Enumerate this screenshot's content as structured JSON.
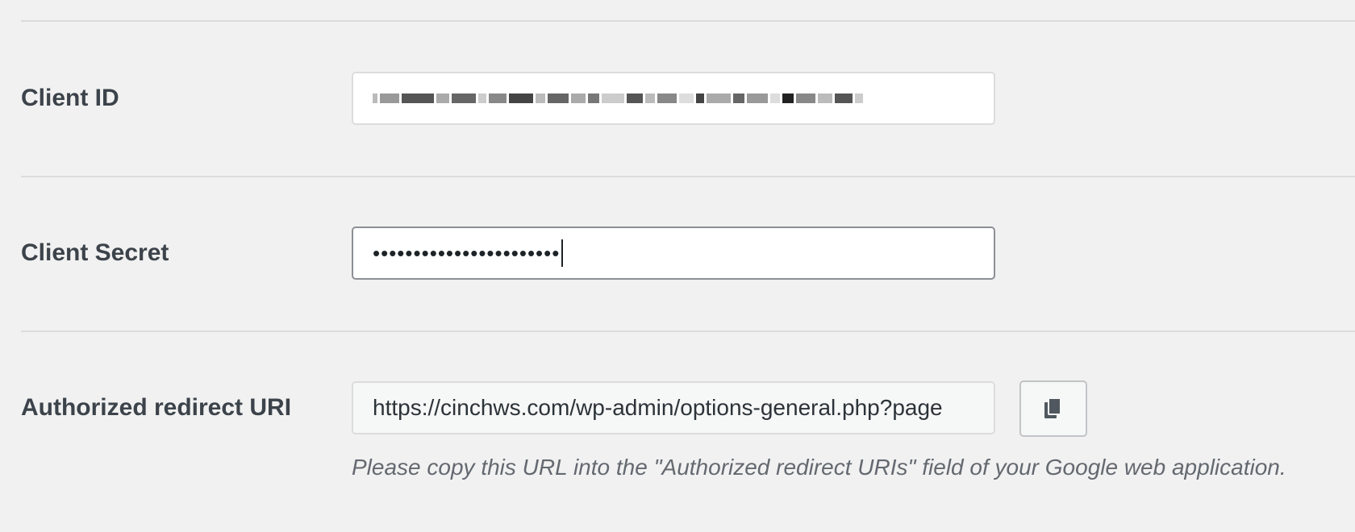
{
  "client_id": {
    "label": "Client ID",
    "value_redacted": true
  },
  "client_secret": {
    "label": "Client Secret",
    "masked_value": "•••••••••••••••••••••••"
  },
  "redirect_uri": {
    "label": "Authorized redirect URI",
    "value": "https://cinchws.com/wp-admin/options-general.php?page",
    "copy_icon": "copy-icon",
    "description": "Please copy this URL into the \"Authorized redirect URIs\" field of your Google web application."
  }
}
